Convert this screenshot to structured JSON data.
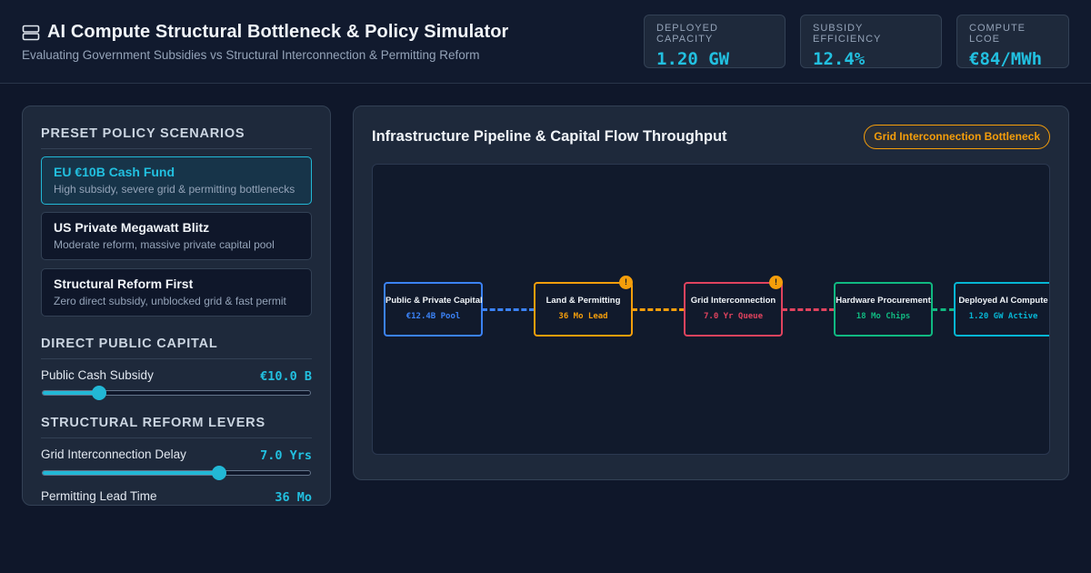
{
  "header": {
    "icon": "server-stack-icon",
    "title": "AI Compute Structural Bottleneck & Policy Simulator",
    "subtitle": "Evaluating Government Subsidies vs Structural Interconnection & Permitting Reform",
    "metrics": [
      {
        "label": "Deployed Capacity",
        "value": "1.20 GW"
      },
      {
        "label": "Subsidy Efficiency",
        "value": "12.4%"
      },
      {
        "label": "Compute LCOE",
        "value": "€84/MWh"
      }
    ]
  },
  "sidebar": {
    "scenarios_title": "Preset Policy Scenarios",
    "scenarios": [
      {
        "name": "EU €10B Cash Fund",
        "desc": "High subsidy, severe grid & permitting bottlenecks",
        "active": true
      },
      {
        "name": "US Private Megawatt Blitz",
        "desc": "Moderate reform, massive private capital pool",
        "active": false
      },
      {
        "name": "Structural Reform First",
        "desc": "Zero direct subsidy, unblocked grid & fast permit",
        "active": false
      }
    ],
    "capital_title": "Direct Public Capital",
    "subsidy": {
      "label": "Public Cash Subsidy",
      "value": "€10.0 B",
      "level": 0.21
    },
    "reform_title": "Structural Reform Levers",
    "grid_delay": {
      "label": "Grid Interconnection Delay",
      "value": "7.0 Yrs",
      "level": 0.66
    },
    "permitting": {
      "label": "Permitting Lead Time",
      "value": "36 Mo"
    }
  },
  "pipeline": {
    "title": "Infrastructure Pipeline & Capital Flow Throughput",
    "badge": "Grid Interconnection Bottleneck",
    "warning_glyph": "!",
    "colors": {
      "capital": "#3b82f6",
      "permitting": "#f59e0b",
      "grid": "#e0435e",
      "hardware": "#10b981",
      "deployed": "#06b6d4"
    },
    "nodes": [
      {
        "name": "Public & Private Capital",
        "value": "€12.4B Pool",
        "warning": false
      },
      {
        "name": "Land & Permitting",
        "value": "36 Mo Lead",
        "warning": true
      },
      {
        "name": "Grid Interconnection",
        "value": "7.0 Yr Queue",
        "warning": true
      },
      {
        "name": "Hardware Procurement",
        "value": "18 Mo Chips",
        "warning": false
      },
      {
        "name": "Deployed AI Compute",
        "value": "1.20 GW Active",
        "warning": false
      }
    ]
  }
}
